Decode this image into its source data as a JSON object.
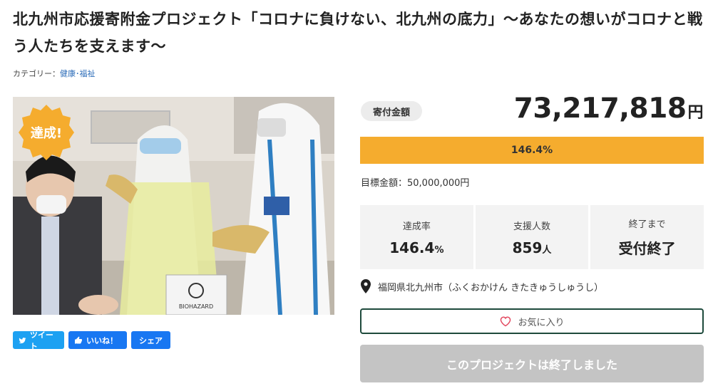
{
  "title": "北九州市応援寄附金プロジェクト「コロナに負けない、北九州の底力」〜あなたの想いがコロナと戦う人たちを支えます〜",
  "category": {
    "label": "カテゴリー：",
    "link": "健康･福祉"
  },
  "photo": {
    "badge": "達成!",
    "bag_label": "BIOHAZARD"
  },
  "social": {
    "tweet": "ツイート",
    "like": "いいね！",
    "share": "シェア"
  },
  "donation": {
    "label": "寄付金額",
    "amount": "73,217,818",
    "unit": "円",
    "progress_text": "146.4%",
    "progress_ratio": 1.0,
    "goal": "目標金額：50,000,000円"
  },
  "stats": {
    "rate_label": "達成率",
    "rate_value": "146.4",
    "rate_unit": "%",
    "supporters_label": "支援人数",
    "supporters_value": "859",
    "supporters_unit": "人",
    "remaining_label": "終了まで",
    "remaining_value": "受付終了"
  },
  "location": "福岡県北九州市（ふくおかけん きたきゅうしゅうし）",
  "favorite_label": "お気に入り",
  "ended_label": "このプロジェクトは終了しました",
  "colors": {
    "progress": "#f5ac2e",
    "fav_border": "#1e4a3c",
    "badge": "#f5ac2e"
  }
}
